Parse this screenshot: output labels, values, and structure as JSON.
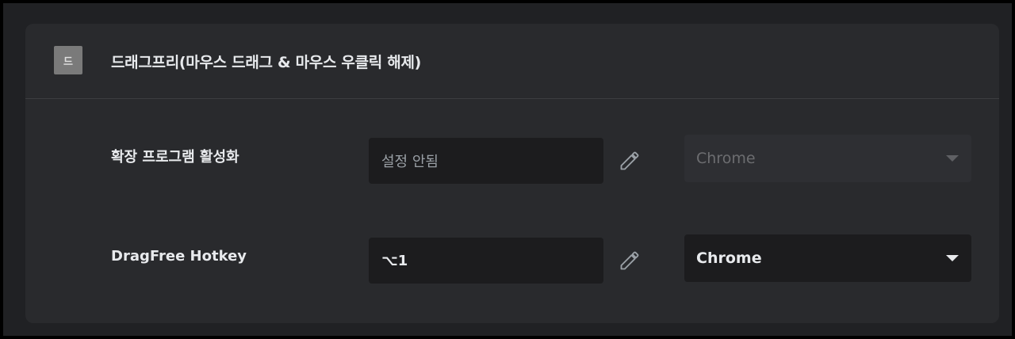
{
  "extension": {
    "icon_text": "드",
    "icon_name": "extension-icon",
    "title": "드래그프리(마우스 드래그 & 마우스 우클릭 해제)"
  },
  "shortcuts": [
    {
      "label": "확장 프로그램 활성화",
      "value": "설정 안됨",
      "scope": "Chrome",
      "scope_enabled": false
    },
    {
      "label": "DragFree Hotkey",
      "value": "⌥1",
      "scope": "Chrome",
      "scope_enabled": true
    }
  ],
  "colors": {
    "background": "#202124",
    "card": "#292a2d",
    "input": "#1c1c1e",
    "text": "#e8eaed",
    "muted": "#9aa0a6"
  }
}
